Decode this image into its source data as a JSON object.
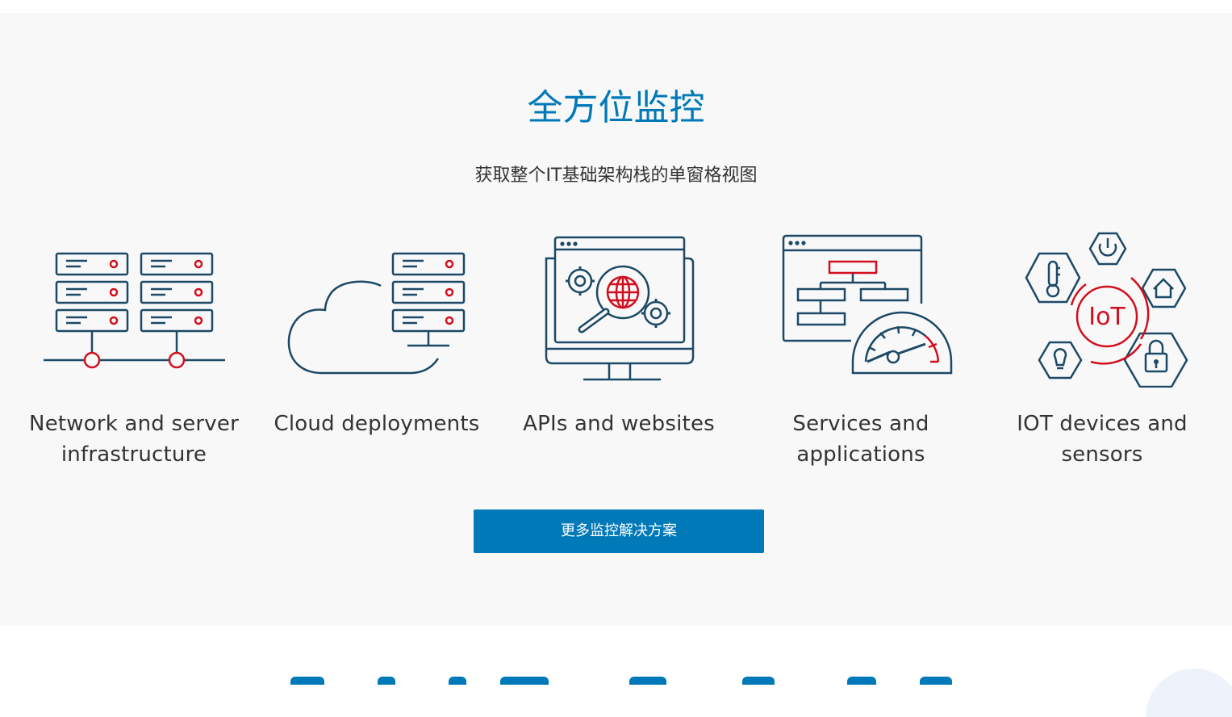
{
  "section": {
    "title": "全方位监控",
    "subtitle": "获取整个IT基础架构栈的单窗格视图",
    "cards": [
      {
        "label": "Network and server infrastructure",
        "icon": "network-server-icon"
      },
      {
        "label": "Cloud deployments",
        "icon": "cloud-server-icon"
      },
      {
        "label": "APIs and websites",
        "icon": "api-website-icon"
      },
      {
        "label": "Services and applications",
        "icon": "services-dashboard-icon"
      },
      {
        "label": "IOT devices and sensors",
        "icon": "iot-hub-icon"
      }
    ],
    "cta_label": "更多监控解决方案"
  },
  "colors": {
    "accent_blue": "#0079b8",
    "icon_navy": "#1c4966",
    "icon_red": "#d10f1e",
    "background": "#f8f8f8"
  },
  "icons": {
    "iot_hub_text": "IoT"
  }
}
